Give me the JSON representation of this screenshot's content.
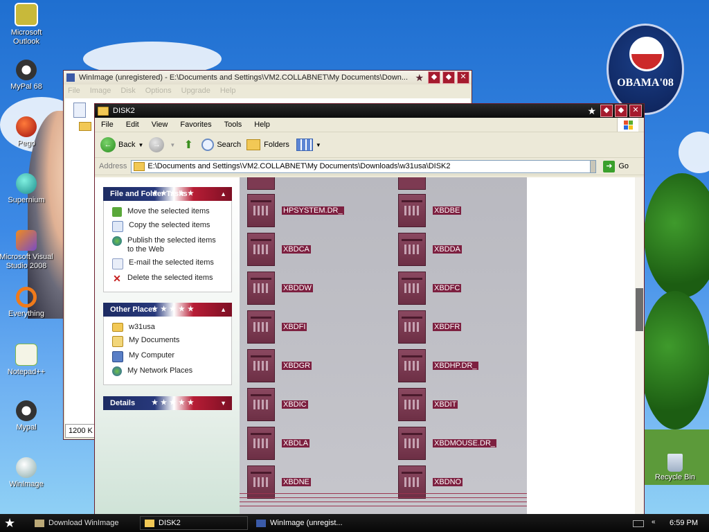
{
  "desktop": {
    "icons": [
      {
        "label": "Microsoft Outlook"
      },
      {
        "label": "MyPal 68"
      },
      {
        "label": "Pego"
      },
      {
        "label": "Supernium"
      },
      {
        "label": "Microsoft Visual Studio 2008"
      },
      {
        "label": "Everything"
      },
      {
        "label": "Notepad++"
      },
      {
        "label": "Mypal"
      },
      {
        "label": "WinImage"
      }
    ],
    "recycle_bin": "Recycle Bin",
    "badge_text": "OBAMA'08"
  },
  "winimage": {
    "title": "WinImage (unregistered) - E:\\Documents and Settings\\VM2.COLLABNET\\My Documents\\Down...",
    "menu": [
      "File",
      "Image",
      "Disk",
      "Options",
      "Upgrade",
      "Help"
    ],
    "status": "1200 K"
  },
  "explorer": {
    "title": "DISK2",
    "menu": [
      "File",
      "Edit",
      "View",
      "Favorites",
      "Tools",
      "Help"
    ],
    "toolbar": {
      "back": "Back",
      "search": "Search",
      "folders": "Folders"
    },
    "address": {
      "label": "Address",
      "value": "E:\\Documents and Settings\\VM2.COLLABNET\\My Documents\\Downloads\\w31usa\\DISK2",
      "go": "Go"
    },
    "file_tasks": {
      "heading": "File and Folder Tasks",
      "items": [
        {
          "label": "Move the selected items"
        },
        {
          "label": "Copy the selected items"
        },
        {
          "label": "Publish the selected items to the Web"
        },
        {
          "label": "E-mail the selected items"
        },
        {
          "label": "Delete the selected items"
        }
      ]
    },
    "other_places": {
      "heading": "Other Places",
      "items": [
        {
          "label": "w31usa"
        },
        {
          "label": "My Documents"
        },
        {
          "label": "My Computer"
        },
        {
          "label": "My Network Places"
        }
      ]
    },
    "details": {
      "heading": "Details"
    },
    "files": [
      {
        "name": "HPSYSTEM.DR_"
      },
      {
        "name": "XBDBE"
      },
      {
        "name": "XBDCA"
      },
      {
        "name": "XBDDA"
      },
      {
        "name": "XBDDW"
      },
      {
        "name": "XBDFC"
      },
      {
        "name": "XBDFI"
      },
      {
        "name": "XBDFR"
      },
      {
        "name": "XBDGR"
      },
      {
        "name": "XBDHP.DR_"
      },
      {
        "name": "XBDIC"
      },
      {
        "name": "XBDIT"
      },
      {
        "name": "XBDLA"
      },
      {
        "name": "XBDMOUSE.DR_"
      },
      {
        "name": "XBDNE"
      },
      {
        "name": "XBDNO"
      }
    ]
  },
  "taskbar": {
    "items": [
      {
        "label": "Download WinImage"
      },
      {
        "label": "DISK2"
      },
      {
        "label": "WinImage (unregist..."
      }
    ],
    "clock": "6:59 PM"
  },
  "colors": {
    "accent_maroon": "#7d2040",
    "titlebar": "#0d0d0d",
    "panel_blue": "#1d2c63",
    "panel_red": "#b71d35"
  }
}
